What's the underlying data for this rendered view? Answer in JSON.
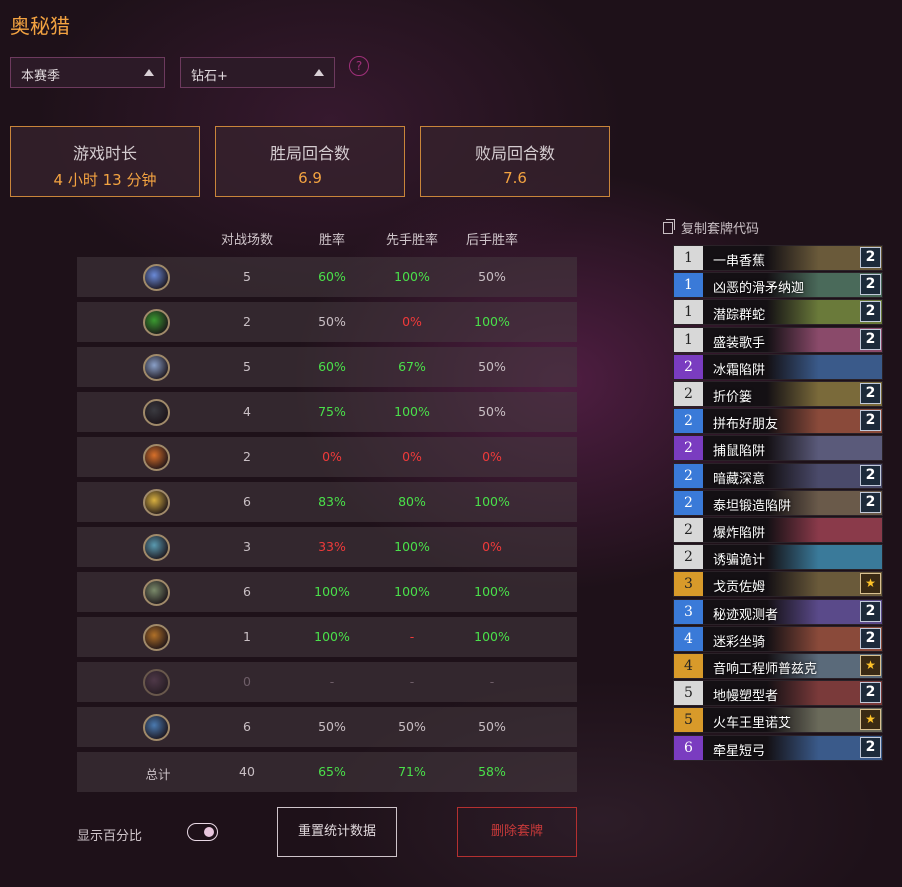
{
  "title": "奥秘猎",
  "filters": {
    "season": "本赛季",
    "rank": "钻石+",
    "help": "?"
  },
  "stats": [
    {
      "label": "游戏时长",
      "value": "4 小时 13 分钟"
    },
    {
      "label": "胜局回合数",
      "value": "6.9"
    },
    {
      "label": "败局回合数",
      "value": "7.6"
    }
  ],
  "table": {
    "headers": [
      "对战场数",
      "胜率",
      "先手胜率",
      "后手胜率"
    ],
    "rows": [
      {
        "icon": "mage-class-icon",
        "color": "#6a8ad8",
        "games": "5",
        "wr": "60%",
        "first": "100%",
        "second": "50%",
        "wr_c": "green",
        "first_c": "green",
        "second_c": "white"
      },
      {
        "icon": "druid-class-icon",
        "color": "#3a9a30",
        "games": "2",
        "wr": "50%",
        "first": "0%",
        "second": "100%",
        "wr_c": "white",
        "first_c": "red",
        "second_c": "green"
      },
      {
        "icon": "shaman-class-icon",
        "color": "#8aa0c8",
        "games": "5",
        "wr": "60%",
        "first": "67%",
        "second": "50%",
        "wr_c": "green",
        "first_c": "green",
        "second_c": "white"
      },
      {
        "icon": "rogue-class-icon",
        "color": "#3a3a40",
        "games": "4",
        "wr": "75%",
        "first": "100%",
        "second": "50%",
        "wr_c": "green",
        "first_c": "green",
        "second_c": "white"
      },
      {
        "icon": "warlock-class-icon",
        "color": "#d8702a",
        "games": "2",
        "wr": "0%",
        "first": "0%",
        "second": "0%",
        "wr_c": "red",
        "first_c": "red",
        "second_c": "red"
      },
      {
        "icon": "paladin-class-icon",
        "color": "#d8b040",
        "games": "6",
        "wr": "83%",
        "first": "80%",
        "second": "100%",
        "wr_c": "green",
        "first_c": "green",
        "second_c": "green"
      },
      {
        "icon": "warrior-class-icon",
        "color": "#5a9ab0",
        "games": "3",
        "wr": "33%",
        "first": "100%",
        "second": "0%",
        "wr_c": "red",
        "first_c": "green",
        "second_c": "red"
      },
      {
        "icon": "hunter-class-icon",
        "color": "#7a8a6a",
        "games": "6",
        "wr": "100%",
        "first": "100%",
        "second": "100%",
        "wr_c": "green",
        "first_c": "green",
        "second_c": "green"
      },
      {
        "icon": "demon-hunter-class-icon",
        "color": "#b07028",
        "games": "1",
        "wr": "100%",
        "first": "-",
        "second": "100%",
        "wr_c": "green",
        "first_c": "red",
        "second_c": "green"
      },
      {
        "icon": "death-knight-class-icon",
        "color": "#6a4a62",
        "games": "0",
        "wr": "-",
        "first": "-",
        "second": "-",
        "wr_c": "dim",
        "first_c": "dim",
        "second_c": "dim",
        "dim": true
      },
      {
        "icon": "priest-class-icon",
        "color": "#4a7ab0",
        "games": "6",
        "wr": "50%",
        "first": "50%",
        "second": "50%",
        "wr_c": "white",
        "first_c": "white",
        "second_c": "white"
      }
    ],
    "total": {
      "label": "总计",
      "games": "40",
      "wr": "65%",
      "first": "71%",
      "second": "58%"
    }
  },
  "controls": {
    "show_percent_label": "显示百分比",
    "show_percent_on": true,
    "reset_label": "重置统计数据",
    "delete_label": "删除套牌"
  },
  "deck": {
    "copy_label": "复制套牌代码",
    "cards": [
      {
        "cost": "1",
        "name": "一串香蕉",
        "rarity": "c1",
        "qty": "2",
        "art": "#6a5a3a"
      },
      {
        "cost": "1",
        "name": "凶恶的滑矛纳迦",
        "rarity": "c2",
        "qty": "2",
        "art": "#4a6a5a"
      },
      {
        "cost": "1",
        "name": "潜踪群蛇",
        "rarity": "c1",
        "qty": "2",
        "art": "#6a7a3a"
      },
      {
        "cost": "1",
        "name": "盛装歌手",
        "rarity": "c1",
        "qty": "2",
        "art": "#8a4a6a"
      },
      {
        "cost": "2",
        "name": "冰霜陷阱",
        "rarity": "c3",
        "qty": "",
        "art": "#3a5a8a"
      },
      {
        "cost": "2",
        "name": "折价篓",
        "rarity": "c1",
        "qty": "2",
        "art": "#7a6a3a"
      },
      {
        "cost": "2",
        "name": "拼布好朋友",
        "rarity": "c2",
        "qty": "2",
        "art": "#8a4a3a"
      },
      {
        "cost": "2",
        "name": "捕鼠陷阱",
        "rarity": "c3",
        "qty": "",
        "art": "#5a5a7a"
      },
      {
        "cost": "2",
        "name": "暗藏深意",
        "rarity": "c2",
        "qty": "2",
        "art": "#4a4a6a"
      },
      {
        "cost": "2",
        "name": "泰坦锻造陷阱",
        "rarity": "c2",
        "qty": "2",
        "art": "#6a5a4a"
      },
      {
        "cost": "2",
        "name": "爆炸陷阱",
        "rarity": "c1",
        "qty": "",
        "art": "#8a3a4a"
      },
      {
        "cost": "2",
        "name": "诱骗诡计",
        "rarity": "c1",
        "qty": "",
        "art": "#3a7a9a"
      },
      {
        "cost": "3",
        "name": "戈贡佐姆",
        "rarity": "c4",
        "qty": "★",
        "art": "#6a5a3a"
      },
      {
        "cost": "3",
        "name": "秘迹观测者",
        "rarity": "c2",
        "qty": "2",
        "art": "#5a4a8a"
      },
      {
        "cost": "4",
        "name": "迷彩坐骑",
        "rarity": "c2",
        "qty": "2",
        "art": "#8a4a3a"
      },
      {
        "cost": "4",
        "name": "音响工程师普兹克",
        "rarity": "c4",
        "qty": "★",
        "art": "#5a6a7a"
      },
      {
        "cost": "5",
        "name": "地幔塑型者",
        "rarity": "c1",
        "qty": "2",
        "art": "#7a3a3a"
      },
      {
        "cost": "5",
        "name": "火车王里诺艾",
        "rarity": "c4",
        "qty": "★",
        "art": "#6a6a5a"
      },
      {
        "cost": "6",
        "name": "牵星短弓",
        "rarity": "c3",
        "qty": "2",
        "art": "#3a5a8a"
      }
    ]
  }
}
